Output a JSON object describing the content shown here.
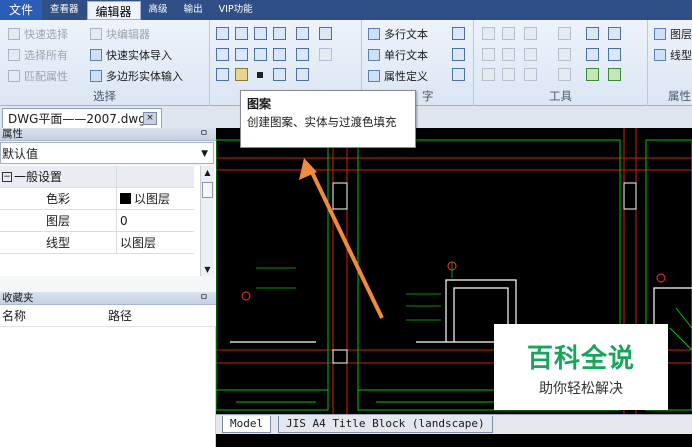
{
  "menubar": {
    "items": [
      "文件",
      "查看器",
      "编辑器",
      "高级",
      "输出",
      "VIP功能"
    ],
    "active": "编辑器"
  },
  "ribbon": {
    "select_group": {
      "title": "选择",
      "buttons": [
        "快速选择",
        "块编辑器",
        "选择所有",
        "快速实体导入",
        "匹配属性",
        "多边形实体输入"
      ]
    },
    "draw_group": {
      "title": ""
    },
    "text_group": {
      "title": "字",
      "buttons": [
        "多行文本",
        "单行文本",
        "属性定义"
      ]
    },
    "tools_group": {
      "title": "工具"
    },
    "props_group": {
      "title": "属性",
      "buttons": [
        "图层",
        "线型"
      ]
    }
  },
  "document_tab": {
    "label": "DWG平面——2007.dwg",
    "close": "×"
  },
  "properties_panel": {
    "title": "属性",
    "pin": "ㅁ",
    "combo_value": "默认值",
    "section": "一般设置",
    "rows": [
      {
        "key": "色彩",
        "value": "以图层"
      },
      {
        "key": "图层",
        "value": "0"
      },
      {
        "key": "线型",
        "value": "以图层"
      }
    ]
  },
  "favorites_panel": {
    "title": "收藏夹",
    "pin": "ㅁ",
    "columns": [
      "名称",
      "路径"
    ]
  },
  "tooltip": {
    "title": "图案",
    "desc": "创建图案、实体与过渡色填充"
  },
  "model_tabs": [
    "Model",
    "JIS A4 Title Block (landscape)"
  ],
  "watermark": {
    "main": "百科全说",
    "sub": "助你轻松解决"
  },
  "colors": {
    "menubar": "#2f4f86",
    "canvas": "#000000",
    "cad_green": "#00c800",
    "cad_red": "#d21a1a",
    "arrow": "#f08a3c",
    "watermark_green": "#18a55b"
  }
}
